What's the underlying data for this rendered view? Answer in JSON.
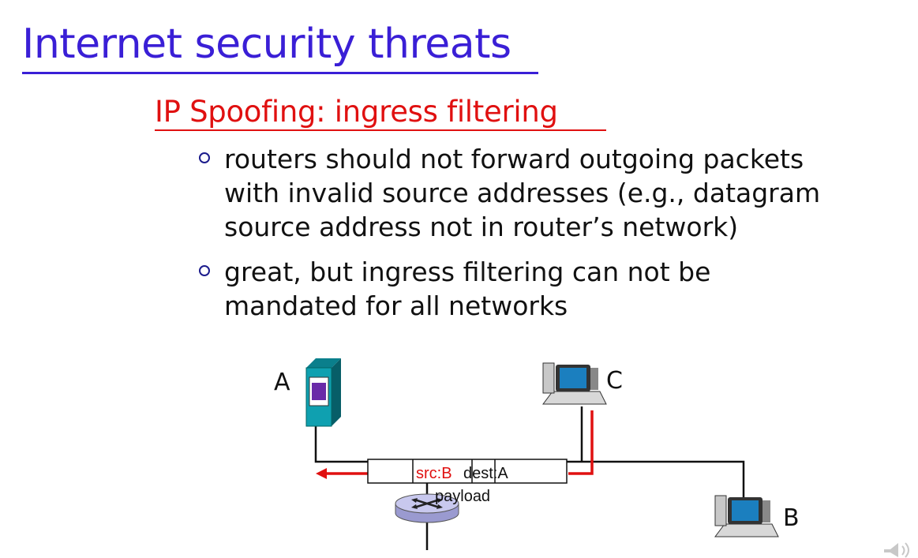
{
  "slide": {
    "title": "Internet security threats",
    "subtitle": "IP Spoofing: ingress filtering",
    "bullets": [
      "routers should not forward outgoing packets with invalid source addresses (e.g., datagram source address not in router’s network)",
      "great, but ingress filtering can not be mandated for all networks"
    ]
  },
  "diagram": {
    "nodes": {
      "a_label": "A",
      "c_label": "C",
      "b_label": "B"
    },
    "packet": {
      "src": "src:B",
      "dest": "dest:A",
      "payload": "payload"
    }
  },
  "colors": {
    "title": "#3a1fd6",
    "subtitle": "#e01010",
    "path": "#e01010",
    "server": "#0fa0b0",
    "router": "#b8b8e0"
  }
}
